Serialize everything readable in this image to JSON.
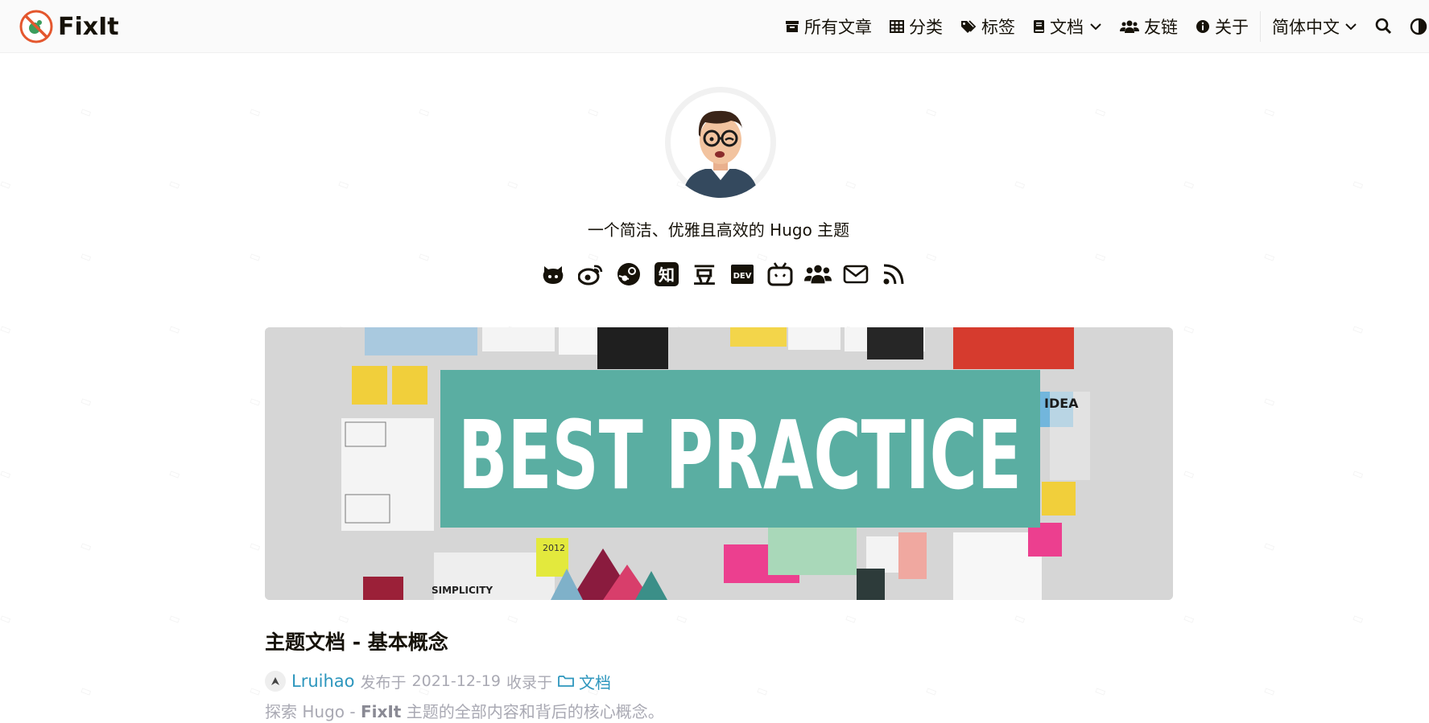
{
  "header": {
    "logo_title": "FixIt",
    "menu": [
      {
        "label": "所有文章",
        "icon": "archive-icon"
      },
      {
        "label": "分类",
        "icon": "table-icon"
      },
      {
        "label": "标签",
        "icon": "tags-icon"
      },
      {
        "label": "文档",
        "icon": "book-icon",
        "has_dropdown": true
      },
      {
        "label": "友链",
        "icon": "users-icon"
      },
      {
        "label": "关于",
        "icon": "info-circle-icon"
      }
    ],
    "language": "简体中文",
    "icons": [
      "search-icon",
      "theme-switch-icon"
    ]
  },
  "profile": {
    "subtitle": "一个简洁、优雅且高效的 Hugo 主题",
    "social": [
      {
        "name": "github-icon"
      },
      {
        "name": "weibo-icon"
      },
      {
        "name": "steam-icon"
      },
      {
        "name": "zhihu-icon",
        "glyph": "知"
      },
      {
        "name": "douban-icon",
        "glyph": "豆"
      },
      {
        "name": "dev-icon",
        "glyph": "DEV"
      },
      {
        "name": "bilibili-icon"
      },
      {
        "name": "users-icon"
      },
      {
        "name": "email-icon"
      },
      {
        "name": "rss-icon"
      }
    ]
  },
  "post": {
    "featured_text": "BEST PRACTICE",
    "featured_note": "2012",
    "featured_caption": "SIMPLICITY",
    "featured_idea": "IDEA",
    "title": "主题文档 - 基本概念",
    "author": "Lruihao",
    "published_prefix": "发布于",
    "date": "2021-12-19",
    "category_prefix": "收录于",
    "category": "文档",
    "summary_prefix": "探索 Hugo - ",
    "summary_bold": "FixIt",
    "summary_suffix": " 主题的全部内容和背后的核心概念。"
  },
  "colors": {
    "accent": "#2d96bd",
    "text": "#161209",
    "muted": "#a9a9b3",
    "banner_teal": "#5aaea2"
  }
}
